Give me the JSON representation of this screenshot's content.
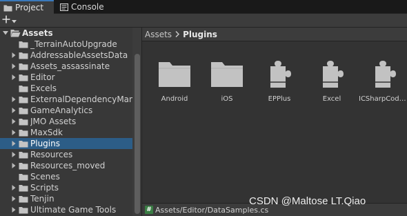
{
  "tabs": [
    {
      "label": "Project",
      "icon": "folder-icon",
      "active": true
    },
    {
      "label": "Console",
      "icon": "console-icon",
      "active": false
    }
  ],
  "toolbar": {
    "add_icon": "plus-icon",
    "dropdown_icon": "chevron-down-icon"
  },
  "tree": {
    "root": {
      "label": "Assets",
      "expanded": true
    },
    "items": [
      {
        "label": "_TerrainAutoUpgrade",
        "has_children": false
      },
      {
        "label": "AddressableAssetsData",
        "has_children": true
      },
      {
        "label": "Assets_assassinate",
        "has_children": true
      },
      {
        "label": "Editor",
        "has_children": true
      },
      {
        "label": "Excels",
        "has_children": false
      },
      {
        "label": "ExternalDependencyManager",
        "has_children": true
      },
      {
        "label": "GameAnalytics",
        "has_children": true
      },
      {
        "label": "JMO Assets",
        "has_children": true
      },
      {
        "label": "MaxSdk",
        "has_children": true
      },
      {
        "label": "Plugins",
        "has_children": true,
        "selected": true
      },
      {
        "label": "Resources",
        "has_children": true
      },
      {
        "label": "Resources_moved",
        "has_children": true
      },
      {
        "label": "Scenes",
        "has_children": false
      },
      {
        "label": "Scripts",
        "has_children": true
      },
      {
        "label": "Tenjin",
        "has_children": true
      },
      {
        "label": "Ultimate Game Tools",
        "has_children": true
      }
    ]
  },
  "breadcrumb": {
    "root": "Assets",
    "separator_icon": "chevron-right-icon",
    "current": "Plugins"
  },
  "assets": [
    {
      "name": "Android",
      "icon": "folder-icon"
    },
    {
      "name": "iOS",
      "icon": "folder-icon"
    },
    {
      "name": "EPPlus",
      "icon": "plugin-icon"
    },
    {
      "name": "Excel",
      "icon": "plugin-icon"
    },
    {
      "name": "ICSharpCode.SharpZipLib",
      "icon": "plugin-icon"
    }
  ],
  "status": {
    "path": "Assets/Editor/DataSamples.cs",
    "icon": "csharp-script-icon",
    "icon_glyph": "#"
  },
  "watermark": "CSDN @Maltose LT.Qiao",
  "colors": {
    "selection": "#2c5d87",
    "tab_accent": "#3a79bb",
    "csharp": "#3a7d44"
  }
}
